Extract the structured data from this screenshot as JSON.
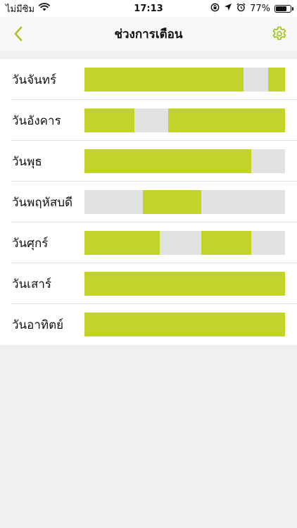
{
  "status_bar": {
    "carrier": "ไม่มีซิม",
    "time": "17:13",
    "battery_text": "77%",
    "battery_level": 0.77,
    "icons": [
      "wifi-icon",
      "orientation-lock-icon",
      "location-icon",
      "alarm-icon",
      "battery-icon"
    ]
  },
  "nav": {
    "title": "ช่วงการเตือน",
    "back_icon": "chevron-left-icon",
    "settings_icon": "gear-icon"
  },
  "colors": {
    "accent": "#c2d32c",
    "inactive": "#e2e2e2",
    "background": "#f0f0f0"
  },
  "schedule": {
    "unit": "fraction of day",
    "days": [
      {
        "label": "วันจันทร์",
        "active_ranges": [
          [
            0.0,
            0.792
          ],
          [
            0.917,
            1.0
          ]
        ]
      },
      {
        "label": "วันอังคาร",
        "active_ranges": [
          [
            0.0,
            0.25
          ],
          [
            0.417,
            1.0
          ]
        ]
      },
      {
        "label": "วันพุธ",
        "active_ranges": [
          [
            0.0,
            0.833
          ]
        ]
      },
      {
        "label": "วันพฤหัสบดี",
        "active_ranges": [
          [
            0.292,
            0.583
          ]
        ]
      },
      {
        "label": "วันศุกร์",
        "active_ranges": [
          [
            0.0,
            0.375
          ],
          [
            0.583,
            0.833
          ]
        ]
      },
      {
        "label": "วันเสาร์",
        "active_ranges": [
          [
            0.0,
            1.0
          ]
        ]
      },
      {
        "label": "วันอาทิตย์",
        "active_ranges": [
          [
            0.0,
            1.0
          ]
        ]
      }
    ]
  }
}
